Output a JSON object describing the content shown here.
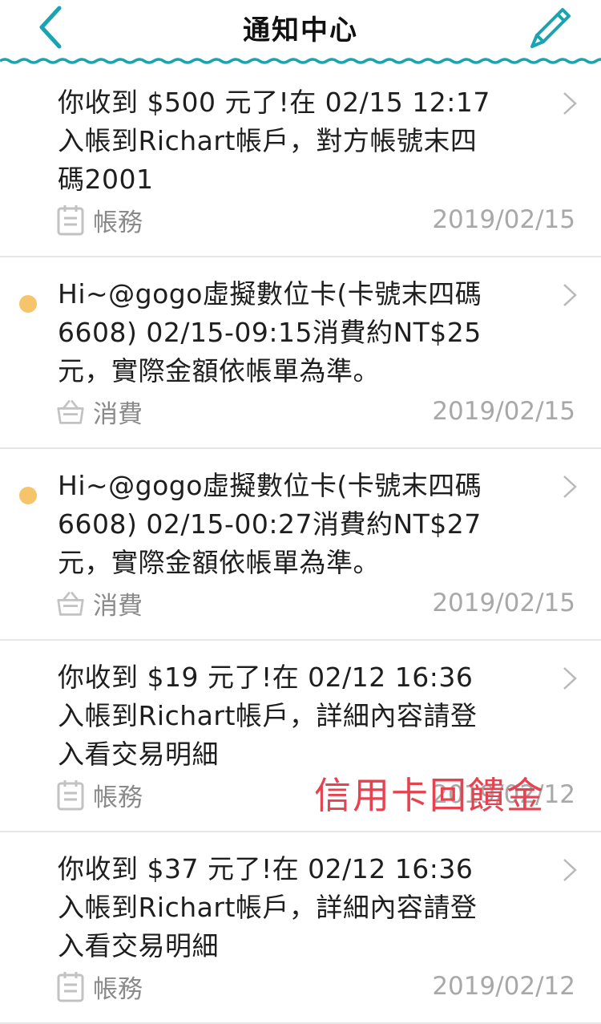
{
  "header": {
    "title": "通知中心"
  },
  "notifications": [
    {
      "message": "你收到 $500 元了!在 02/15 12:17 入帳到Richart帳戶，對方帳號末四碼2001",
      "category": "帳務",
      "date": "2019/02/15",
      "unread": false
    },
    {
      "message": "Hi~@gogo虛擬數位卡(卡號末四碼6608) 02/15-09:15消費約NT$25元，實際金額依帳單為準。",
      "category": "消費",
      "date": "2019/02/15",
      "unread": true
    },
    {
      "message": "Hi~@gogo虛擬數位卡(卡號末四碼6608) 02/15-00:27消費約NT$27元，實際金額依帳單為準。",
      "category": "消費",
      "date": "2019/02/15",
      "unread": true
    },
    {
      "message": "你收到 $19 元了!在 02/12 16:36 入帳到Richart帳戶，詳細內容請登入看交易明細",
      "category": "帳務",
      "date": "2019/02/12",
      "unread": false
    },
    {
      "message": "你收到 $37 元了!在 02/12 16:36 入帳到Richart帳戶，詳細內容請登入看交易明細",
      "category": "帳務",
      "date": "2019/02/12",
      "unread": false
    }
  ],
  "overlay_text": "信用卡回饋金",
  "colors": {
    "accent": "#1aa3b1",
    "unread_dot": "#f6c56b",
    "overlay": "#e6424f"
  }
}
